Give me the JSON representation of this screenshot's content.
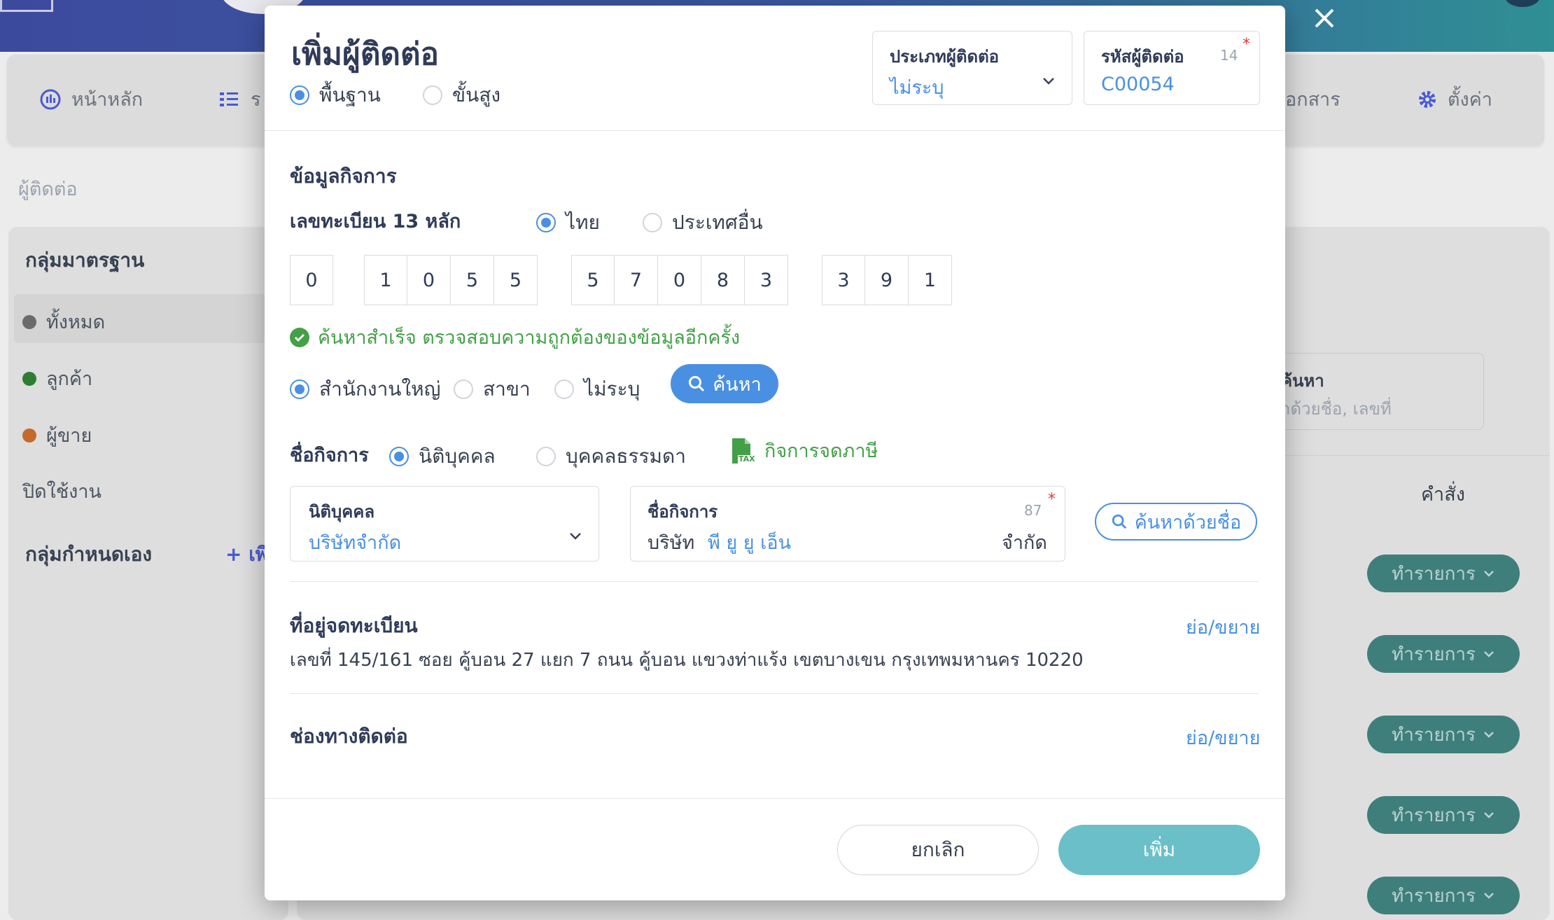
{
  "background": {
    "nav": {
      "home": "หน้าหลัก",
      "second_partial": "ร",
      "docs_partial": "อกสาร",
      "settings": "ตั้งค่า"
    },
    "breadcrumb": "ผู้ติดต่อ",
    "sidebar": {
      "standard_title": "กลุ่มมาตรฐาน",
      "items": [
        {
          "label": "ทั้งหมด",
          "color": "#6b6b6b"
        },
        {
          "label": "ลูกค้า",
          "color": "#2e7d32"
        },
        {
          "label": "ผู้ขาย",
          "color": "#c46a2a"
        }
      ],
      "disabled": "ปิดใช้งาน",
      "custom_title": "กลุ่มกำหนดเอง",
      "add_partial": "+ เพิ"
    },
    "search_card": {
      "label": "ค้นหา",
      "placeholder": "าด้วยชื่อ, เลขที่"
    },
    "column_command": "คำสั่ง",
    "row_button_label": "ทำรายการ",
    "row_count": 5
  },
  "modal": {
    "title": "เพิ่มผู้ติดต่อ",
    "mode_options": [
      {
        "label": "พื้นฐาน",
        "selected": true
      },
      {
        "label": "ขั้นสูง",
        "selected": false
      }
    ],
    "contact_type": {
      "label": "ประเภทผู้ติดต่อ",
      "value": "ไม่ระบุ"
    },
    "contact_code": {
      "label": "รหัสผู้ติดต่อ",
      "value": "C00054",
      "count": "14",
      "required": "*"
    },
    "business_section_title": "ข้อมูลกิจการ",
    "tax_id_label": "เลขทะเบียน 13 หลัก",
    "country_options": [
      {
        "label": "ไทย",
        "selected": true
      },
      {
        "label": "ประเทศอื่น",
        "selected": false
      }
    ],
    "tax_id_groups": [
      [
        "0"
      ],
      [
        "1",
        "0",
        "5",
        "5"
      ],
      [
        "5",
        "7",
        "0",
        "8",
        "3"
      ],
      [
        "3",
        "9",
        "1"
      ]
    ],
    "success_message": "ค้นหาสำเร็จ ตรวจสอบความถูกต้องของข้อมูลอีกครั้ง",
    "branch_options": [
      {
        "label": "สำนักงานใหญ่",
        "selected": true
      },
      {
        "label": "สาขา",
        "selected": false
      },
      {
        "label": "ไม่ระบุ",
        "selected": false
      }
    ],
    "search_button": "ค้นหา",
    "business_name_label": "ชื่อกิจการ",
    "entity_options": [
      {
        "label": "นิติบุคคล",
        "selected": true
      },
      {
        "label": "บุคคลธรรมดา",
        "selected": false
      }
    ],
    "tax_registered": "กิจการจดภาษี",
    "tax_icon_text": "TAX",
    "entity_type": {
      "label": "นิติบุคคล",
      "value": "บริษัทจำกัด"
    },
    "business_name": {
      "label": "ชื่อกิจการ",
      "prefix": "บริษัท",
      "value": "พี ยู ยู เอ็น",
      "suffix": "จำกัด",
      "count": "87",
      "required": "*"
    },
    "search_by_name_button": "ค้นหาด้วยชื่อ",
    "registered_address": {
      "title": "ที่อยู่จดทะเบียน",
      "toggle": "ย่อ/ขยาย",
      "text": "เลขที่ 145/161 ซอย คู้บอน 27 แยก 7 ถนน คู้บอน แขวงท่าแร้ง เขตบางเขน กรุงเทพมหานคร 10220"
    },
    "contact_channels": {
      "title": "ช่องทางติดต่อ",
      "toggle": "ย่อ/ขยาย"
    },
    "cancel_button": "ยกเลิก",
    "add_button": "เพิ่ม"
  }
}
